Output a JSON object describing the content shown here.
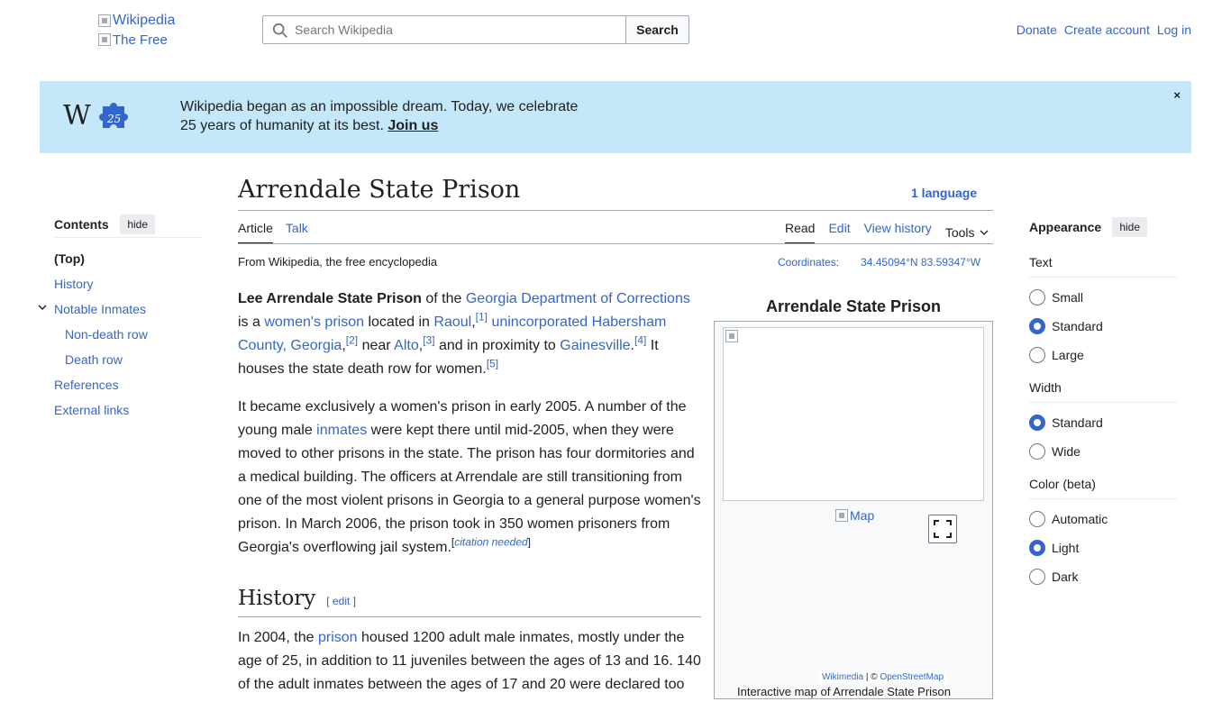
{
  "header": {
    "logo_alt": "Wikipedia",
    "logo_sub_alt": "The Free",
    "search_placeholder": "Search Wikipedia",
    "search_button": "Search",
    "links": [
      "Donate",
      "Create account",
      "Log in"
    ]
  },
  "banner": {
    "line1": "Wikipedia began as an impossible dream. Today, we celebrate",
    "line2": "25 years of humanity at its best.",
    "cta": "Join us",
    "close": "×",
    "logo_number": "25"
  },
  "toc": {
    "title": "Contents",
    "hide": "hide",
    "items": [
      "(Top)",
      "History",
      "Notable Inmates",
      "Non-death row",
      "Death row",
      "References",
      "External links"
    ]
  },
  "article": {
    "title": "Arrendale State Prison",
    "language": "1 language",
    "tabs_left": [
      "Article",
      "Talk"
    ],
    "tabs_right": [
      "Read",
      "Edit",
      "View history"
    ],
    "tools": "Tools",
    "from": "From Wikipedia, the free encyclopedia",
    "coords_label": "Coordinates:",
    "coords_value": "34.45094°N 83.59347°W",
    "p1": {
      "b": "Lee Arrendale State Prison",
      "t1": " of the ",
      "l1": "Georgia Department of Corrections",
      "t2": " is a ",
      "l2": "women's prison",
      "t3": " located in ",
      "l3": "Raoul",
      "r1": "[1]",
      "l4": "unincorporated Habersham County, Georgia",
      "r2": "[2]",
      "t4": " near ",
      "l5": "Alto",
      "r3": "[3]",
      "t5": " and in proximity to ",
      "l6": "Gainesville",
      "r4": "[4]",
      "t6": " It houses the state death row for women.",
      "r5": "[5]"
    },
    "p2": {
      "t1": "It became exclusively a women's prison in early 2005. A number of the young male ",
      "l1": "inmates",
      "t2": " were kept there until mid-2005, when they were moved to other prisons in the state. The prison has four dormitories and a medical building. The officers at Arrendale are still transitioning from one of the most violent prisons in Georgia to a general purpose women's prison. In March 2006, the prison took in 350 women prisoners from Georgia's overflowing jail system.",
      "cn": "citation needed"
    },
    "h2": "History",
    "edit": "edit",
    "p3": {
      "t1": "In 2004, the ",
      "l1": "prison",
      "t2": " housed 1200 adult male inmates, mostly under the age of 25, in addition to 11 juveniles between the ages of 13 and 16. 140 of the adult inmates between the ages of 17 and 20 were declared too"
    }
  },
  "infobox": {
    "title": "Arrendale State Prison",
    "map_alt": "Map",
    "attrib_1": "Wikimedia",
    "attrib_sep": "| ©",
    "attrib_2": "OpenStreetMap",
    "caption": "Interactive map of Arrendale State Prison"
  },
  "appearance": {
    "title": "Appearance",
    "hide": "hide",
    "text_title": "Text",
    "text_options": [
      "Small",
      "Standard",
      "Large"
    ],
    "width_title": "Width",
    "width_options": [
      "Standard",
      "Wide"
    ],
    "color_title": "Color (beta)",
    "color_options": [
      "Automatic",
      "Light",
      "Dark"
    ]
  },
  "colors": {
    "link": "#3366cc",
    "banner": "#c5e7fa",
    "text": "#202122"
  }
}
